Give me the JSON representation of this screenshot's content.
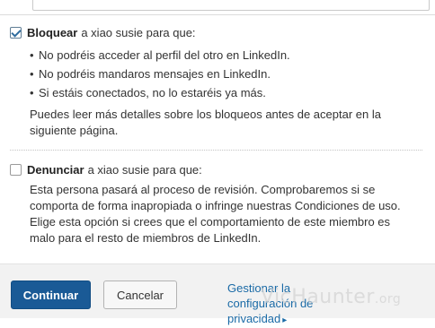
{
  "block_option": {
    "title": "Bloquear",
    "rest": "a xiao susie para que:",
    "checked": true,
    "bullets": [
      "No podréis acceder al perfil del otro en LinkedIn.",
      "No podréis mandaros mensajes en LinkedIn.",
      "Si estáis conectados, no lo estaréis ya más."
    ],
    "note": "Puedes leer más detalles sobre los bloqueos antes de aceptar en la siguiente página."
  },
  "report_option": {
    "title": "Denunciar",
    "rest": "a xiao susie para que:",
    "checked": false,
    "description": "Esta persona pasará al proceso de revisión. Comprobaremos si se comporta de forma inapropiada o infringe nuestras Condiciones de uso. Elige esta opción si crees que el comportamiento de este miembro es malo para el resto de miembros de LinkedIn."
  },
  "footer": {
    "continue_label": "Continuar",
    "cancel_label": "Cancelar",
    "privacy_link": "Gestionar la configuración de privacidad"
  },
  "watermark": {
    "brand": "VicHaunter",
    "tld": ".org"
  },
  "colors": {
    "primary_button": "#1a5a96",
    "link": "#1a6aa6"
  }
}
